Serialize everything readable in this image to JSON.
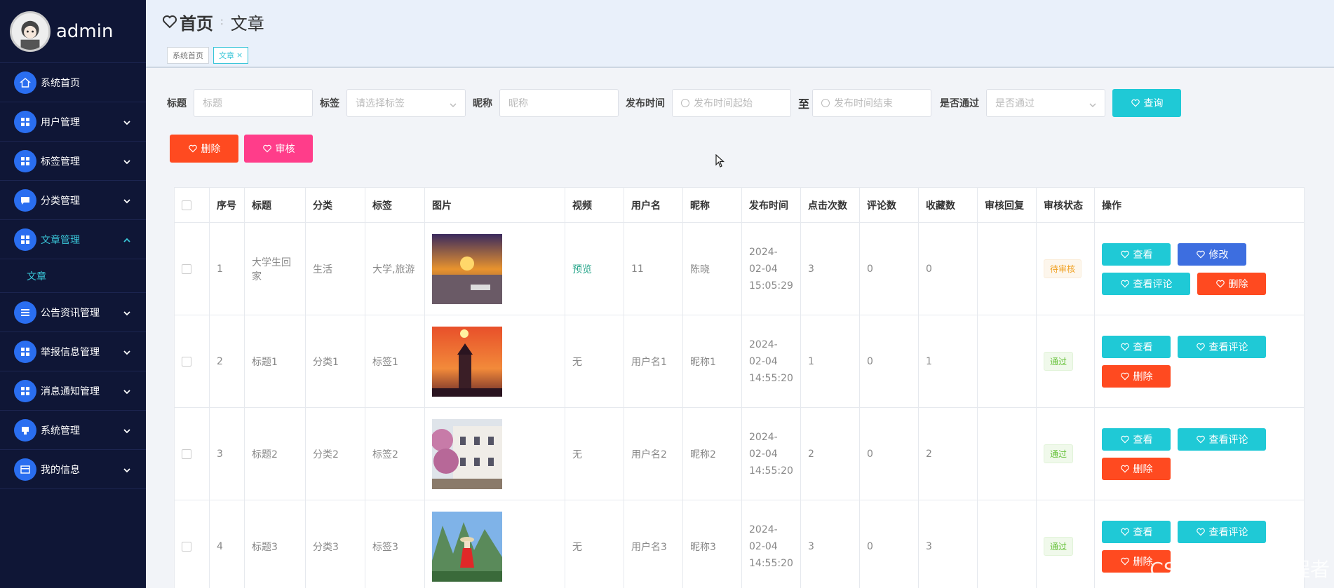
{
  "user": {
    "name": "admin"
  },
  "menu": [
    {
      "label": "系统首页",
      "icon": "home-icon"
    },
    {
      "label": "用户管理",
      "icon": "grid-icon"
    },
    {
      "label": "标签管理",
      "icon": "grid-icon"
    },
    {
      "label": "分类管理",
      "icon": "chat-icon"
    },
    {
      "label": "文章管理",
      "icon": "grid-icon"
    },
    {
      "label": "公告资讯管理",
      "icon": "list-icon"
    },
    {
      "label": "举报信息管理",
      "icon": "grid-icon"
    },
    {
      "label": "消息通知管理",
      "icon": "grid-icon"
    },
    {
      "label": "系统管理",
      "icon": "monitor-icon"
    },
    {
      "label": "我的信息",
      "icon": "card-icon"
    }
  ],
  "submenu": {
    "label": "文章"
  },
  "header": {
    "home": "首页",
    "separator": ":",
    "current": "文章"
  },
  "tabs": [
    {
      "label": "系统首页"
    },
    {
      "label": "文章",
      "close": "×"
    }
  ],
  "search": {
    "title_label": "标题",
    "title_placeholder": "标题",
    "tag_label": "标签",
    "tag_placeholder": "请选择标签",
    "nick_label": "昵称",
    "nick_placeholder": "昵称",
    "time_label": "发布时间",
    "time_start": "发布时间起始",
    "to": "至",
    "time_end": "发布时间结束",
    "pass_label": "是否通过",
    "pass_placeholder": "是否通过",
    "query": "查询"
  },
  "actions": {
    "delete": "删除",
    "review": "审核"
  },
  "columns": [
    "序号",
    "标题",
    "分类",
    "标签",
    "图片",
    "视频",
    "用户名",
    "昵称",
    "发布时间",
    "点击次数",
    "评论数",
    "收藏数",
    "审核回复",
    "审核状态",
    "操作"
  ],
  "rows": [
    {
      "no": "1",
      "title": "大学生回家",
      "cat": "生活",
      "tag": "大学,旅游",
      "video": "预览",
      "user": "11",
      "nick": "陈晓",
      "time": "2024-02-04 15:05:29",
      "clicks": "3",
      "comments": "0",
      "favs": "0",
      "reply": "",
      "status": "待审核",
      "ops": [
        "查看",
        "修改",
        "查看评论",
        "删除"
      ]
    },
    {
      "no": "2",
      "title": "标题1",
      "cat": "分类1",
      "tag": "标签1",
      "video": "无",
      "user": "用户名1",
      "nick": "昵称1",
      "time": "2024-02-04 14:55:20",
      "clicks": "1",
      "comments": "0",
      "favs": "1",
      "reply": "",
      "status": "通过",
      "ops": [
        "查看",
        "查看评论",
        "删除"
      ]
    },
    {
      "no": "3",
      "title": "标题2",
      "cat": "分类2",
      "tag": "标签2",
      "video": "无",
      "user": "用户名2",
      "nick": "昵称2",
      "time": "2024-02-04 14:55:20",
      "clicks": "2",
      "comments": "0",
      "favs": "2",
      "reply": "",
      "status": "通过",
      "ops": [
        "查看",
        "查看评论",
        "删除"
      ]
    },
    {
      "no": "4",
      "title": "标题3",
      "cat": "分类3",
      "tag": "标签3",
      "video": "无",
      "user": "用户名3",
      "nick": "昵称3",
      "time": "2024-02-04 14:55:20",
      "clicks": "3",
      "comments": "0",
      "favs": "3",
      "reply": "",
      "status": "通过",
      "ops": [
        "查看",
        "查看评论",
        "删除"
      ]
    }
  ],
  "watermark": "CSDN @脉冲编程者"
}
